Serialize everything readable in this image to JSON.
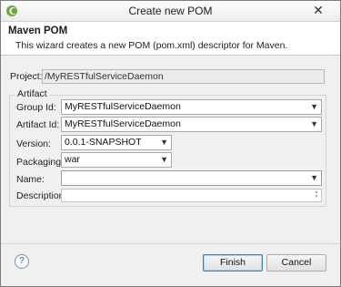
{
  "window": {
    "title": "Create new POM"
  },
  "banner": {
    "title": "Maven POM",
    "description": "This wizard creates a new POM (pom.xml) descriptor for Maven."
  },
  "project": {
    "label": "Project:",
    "value": "/MyRESTfulServiceDaemon"
  },
  "artifact": {
    "group_title": "Artifact",
    "group_id": {
      "label": "Group Id:",
      "value": "MyRESTfulServiceDaemon"
    },
    "artifact_id": {
      "label": "Artifact Id:",
      "value": "MyRESTfulServiceDaemon"
    },
    "version": {
      "label": "Version:",
      "value": "0.0.1-SNAPSHOT"
    },
    "packaging": {
      "label": "Packaging:",
      "value": "war"
    },
    "name": {
      "label": "Name:",
      "value": ""
    },
    "description": {
      "label": "Description:",
      "value": ""
    }
  },
  "buttons": {
    "help": "?",
    "finish": "Finish",
    "cancel": "Cancel"
  },
  "icons": {
    "app": "eclipse-icon",
    "close": "close-icon",
    "dropdown": "chevron-down-icon",
    "help": "help-icon",
    "spin": "scroll-arrows-icon"
  },
  "colors": {
    "accent_border": "#3c7fb1",
    "focus_border": "#7aa7d6"
  }
}
